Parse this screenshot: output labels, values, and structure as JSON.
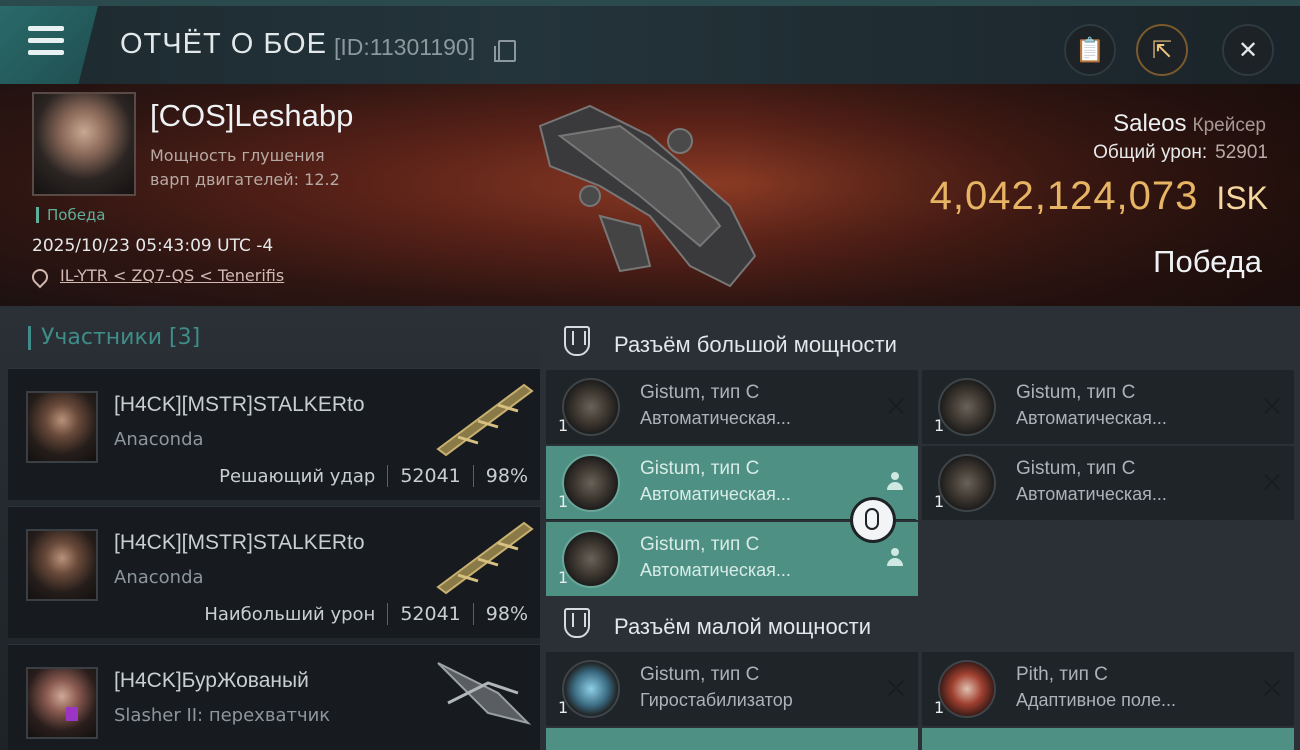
{
  "header": {
    "title": "ОТЧЁТ О БОЕ",
    "battle_id": "[ID:11301190]",
    "icons": [
      "menu-icon",
      "copy-icon",
      "report-icon",
      "share-icon",
      "close-icon"
    ]
  },
  "victim": {
    "name": "[COS]Leshabp",
    "stat_line1": "Мощность глушения",
    "stat_line2": "варп двигателей: 12.2",
    "result": "Победа",
    "datetime": "2025/10/23 05:43:09 UTC -4",
    "location": "IL-YTR < ZQ7-QS < Tenerifis",
    "ship_name": "Saleos",
    "ship_class": "Крейсер",
    "total_damage_label": "Общий урон:",
    "total_damage_value": "52901",
    "isk_amount": "4,042,124,073",
    "isk_unit": "ISK",
    "outcome": "Победа"
  },
  "participants": {
    "header": "Участники [3]",
    "rows": [
      {
        "name": "[H4CK][MSTR]STALKERto",
        "ship": "Anaconda",
        "role": "Решающий удар",
        "damage": "52041",
        "percent": "98%"
      },
      {
        "name": "[H4CK][MSTR]STALKERto",
        "ship": "Anaconda",
        "role": "Наибольший урон",
        "damage": "52041",
        "percent": "98%"
      },
      {
        "name": "[H4CK]БурЖованый",
        "ship": "Slasher II: перехватчик",
        "role": "",
        "damage": "",
        "percent": ""
      }
    ]
  },
  "modules": {
    "high_title": "Разъём большой мощности",
    "low_title": "Разъём малой мощности",
    "high": [
      {
        "qty": "1",
        "name": "Gistum, тип C",
        "desc": "Автоматическая...",
        "state": "destroyed"
      },
      {
        "qty": "1",
        "name": "Gistum, тип C",
        "desc": "Автоматическая...",
        "state": "destroyed"
      },
      {
        "qty": "1",
        "name": "Gistum, тип C",
        "desc": "Автоматическая...",
        "state": "dropped"
      },
      {
        "qty": "1",
        "name": "Gistum, тип C",
        "desc": "Автоматическая...",
        "state": "destroyed"
      },
      {
        "qty": "1",
        "name": "Gistum, тип C",
        "desc": "Автоматическая...",
        "state": "dropped"
      }
    ],
    "low": [
      {
        "qty": "1",
        "name": "Gistum, тип C",
        "desc": "Гиростабилизатор",
        "state": "destroyed"
      },
      {
        "qty": "1",
        "name": "Pith, тип C",
        "desc": "Адаптивное поле...",
        "state": "destroyed"
      }
    ]
  },
  "colors": {
    "accent": "#4e9184",
    "isk": "#e7b464",
    "win": "#5fb09a"
  }
}
